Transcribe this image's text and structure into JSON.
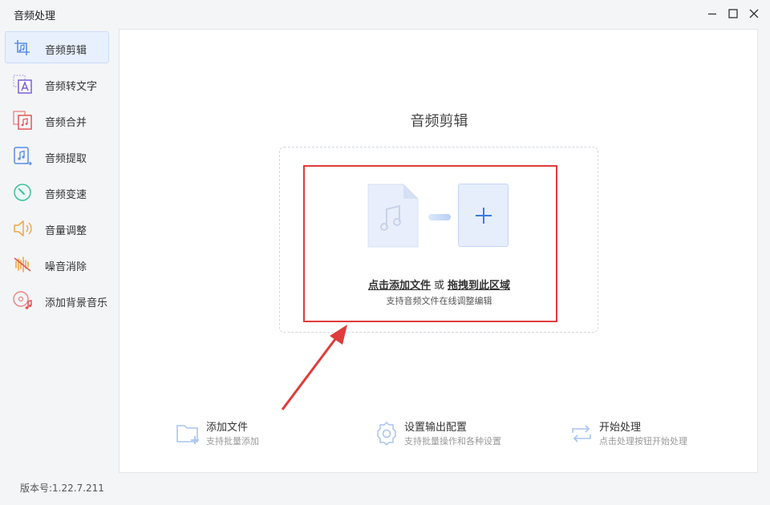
{
  "window": {
    "title": "音频处理",
    "controls": [
      "minimize-icon",
      "maximize-icon",
      "close-icon"
    ]
  },
  "sidebar": {
    "items": [
      {
        "label": "音频剪辑",
        "icon": "audio-cut-icon",
        "active": true
      },
      {
        "label": "音频转文字",
        "icon": "audio-to-text-icon",
        "active": false
      },
      {
        "label": "音频合并",
        "icon": "audio-merge-icon",
        "active": false
      },
      {
        "label": "音频提取",
        "icon": "audio-extract-icon",
        "active": false
      },
      {
        "label": "音频变速",
        "icon": "speed-icon",
        "active": false
      },
      {
        "label": "音量调整",
        "icon": "volume-icon",
        "active": false
      },
      {
        "label": "噪音消除",
        "icon": "noise-reduction-icon",
        "active": false
      },
      {
        "label": "添加背景音乐",
        "icon": "background-music-icon",
        "active": false
      }
    ]
  },
  "version": "版本号:1.22.7.211",
  "main": {
    "title": "音频剪辑",
    "dropzone": {
      "click_text": "点击添加文件",
      "or_text": "或",
      "drag_text": "拖拽到此区域",
      "subtext": "支持音频文件在线调整编辑"
    },
    "actions": [
      {
        "title": "添加文件",
        "subtitle": "支持批量添加",
        "icon": "add-folder-icon"
      },
      {
        "title": "设置输出配置",
        "subtitle": "支持批量操作和各种设置",
        "icon": "gear-icon"
      },
      {
        "title": "开始处理",
        "subtitle": "点击处理按钮开始处理",
        "icon": "repeat-icon"
      }
    ]
  },
  "colors": {
    "accent": "#3a7be0",
    "highlight": "#e03b3b",
    "active_bg": "#e8f0fd"
  }
}
